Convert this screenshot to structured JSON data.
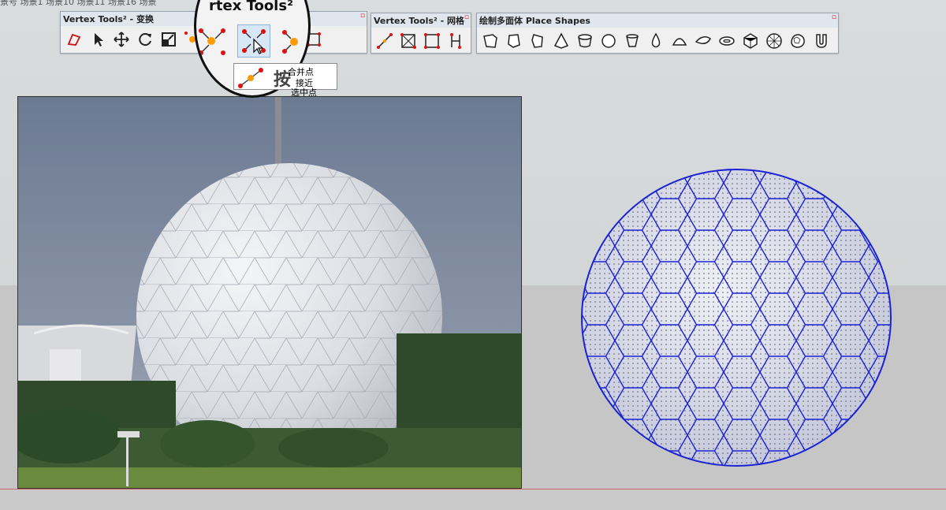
{
  "scene_tabs": "景号  场景1  场景10  场景11  场景16  场景",
  "toolbars": {
    "transform": {
      "title": "Vertex Tools² - 变换",
      "icons": [
        "polygon-select-icon",
        "pointer-icon",
        "move-icon",
        "rotate-icon",
        "scale-icon",
        "merge-vertices-icon",
        "merge-to-nearest-icon",
        "merge-to-selected-icon",
        "edge-icon",
        "face-icon"
      ]
    },
    "mesh": {
      "title": "Vertex Tools² - 网格",
      "icons": [
        "diagonal-edge-icon",
        "triangulate-icon",
        "quad-icon",
        "split-icon"
      ]
    },
    "shapes": {
      "title": "绘制多面体 Place Shapes",
      "icons": [
        "box-shape-icon",
        "prism-shape-icon",
        "pentagon-prism-icon",
        "pyramid-shape-icon",
        "cylinder-shape-icon",
        "sphere-shape-icon",
        "cup-shape-icon",
        "droplet-shape-icon",
        "dome-shape-icon",
        "lens-shape-icon",
        "torus-shape-icon",
        "polyhedron-shape-icon",
        "geosphere-shape-icon",
        "hex-sphere-icon",
        "magnet-shape-icon"
      ]
    }
  },
  "magnifier": {
    "title": "rtex Tools²",
    "tip_big": "按"
  },
  "tooltip": {
    "line1": "合并点",
    "line2a": "接近",
    "line2b": "选中点"
  },
  "colors": {
    "accent": "#ff9a00",
    "vertex": "#d11",
    "mesh_blue": "#1a22d4"
  }
}
